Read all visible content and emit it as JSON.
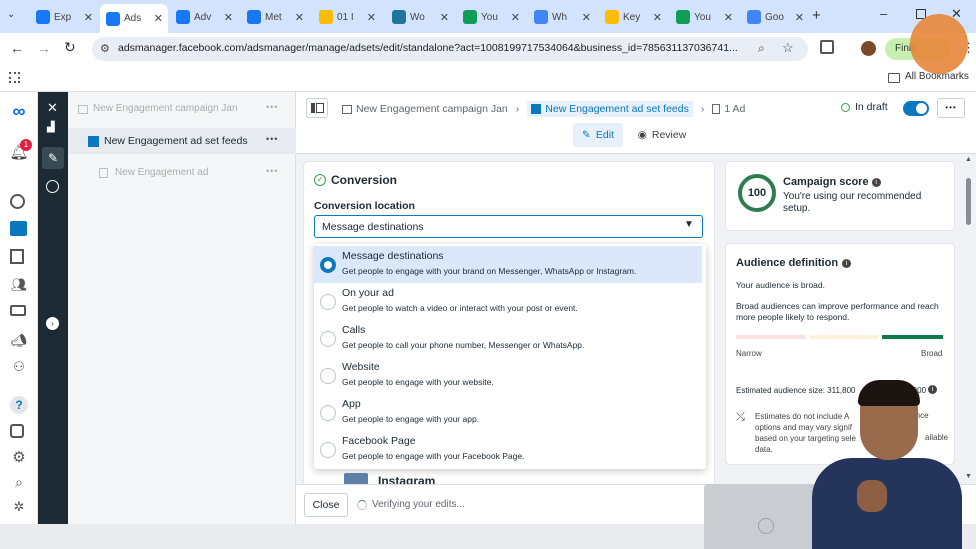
{
  "browser": {
    "tabs": [
      {
        "label": "Exp",
        "color": "#1877f2",
        "icon": "meta"
      },
      {
        "label": "Ads",
        "color": "#1877f2",
        "icon": "meta"
      },
      {
        "label": "Adv",
        "color": "#1877f2",
        "icon": "meta"
      },
      {
        "label": "Met",
        "color": "#1877f2",
        "icon": "meta"
      },
      {
        "label": "01 I",
        "color": "#fbbc04",
        "icon": "drive"
      },
      {
        "label": "Wo",
        "color": "#21759b",
        "icon": "wordpress"
      },
      {
        "label": "You",
        "color": "#0f9d58",
        "icon": "sheets"
      },
      {
        "label": "Wh",
        "color": "#4285f4",
        "icon": "google"
      },
      {
        "label": "Key",
        "color": "#fbbc04",
        "icon": "google-ads"
      },
      {
        "label": "You",
        "color": "#0f9d58",
        "icon": "sheets"
      },
      {
        "label": "Goo",
        "color": "#4285f4",
        "icon": "google"
      }
    ],
    "active_tab": 1,
    "url": "adsmanager.facebook.com/adsmanager/manage/adsets/edit/standalone?act=1008199717534064&business_id=785631137036741...",
    "profile_button": "Finis",
    "all_bookmarks": "All Bookmarks"
  },
  "sidebar": {
    "notification_count": "1",
    "icons": [
      "meta-logo-icon",
      "notifications-icon",
      "dashboard-icon",
      "campaigns-icon",
      "pages-icon",
      "audiences-icon",
      "billing-icon",
      "ads-icon",
      "network-icon",
      "help-icon",
      "reports-icon",
      "settings-icon",
      "search-icon",
      "bug-icon"
    ]
  },
  "tree": {
    "campaign": "New Engagement campaign Jan",
    "adset": "New Engagement ad set feeds",
    "ad": "New Engagement ad",
    "more": "•••"
  },
  "topbar": {
    "crumb_campaign": "New Engagement campaign Jan",
    "crumb_adset": "New Engagement ad set feeds",
    "crumb_ad": "1 Ad",
    "status": "In draft",
    "edit": "Edit",
    "review": "Review",
    "more": "•••"
  },
  "conversion": {
    "title": "Conversion",
    "location_label": "Conversion location",
    "selected": "Message destinations",
    "options": [
      {
        "label": "Message destinations",
        "desc": "Get people to engage with your brand on Messenger, WhatsApp or Instagram.",
        "selected": true
      },
      {
        "label": "On your ad",
        "desc": "Get people to watch a video or interact with your post or event.",
        "selected": false
      },
      {
        "label": "Calls",
        "desc": "Get people to call your phone number, Messenger or WhatsApp.",
        "selected": false
      },
      {
        "label": "Website",
        "desc": "Get people to engage with your website.",
        "selected": false
      },
      {
        "label": "App",
        "desc": "Get people to engage with your app.",
        "selected": false
      },
      {
        "label": "Facebook Page",
        "desc": "Get people to engage with your Facebook Page.",
        "selected": false
      }
    ],
    "below_item": "Instagram"
  },
  "campaign_score": {
    "score": "100",
    "title": "Campaign score",
    "text": "You're using our recommended setup."
  },
  "audience": {
    "title": "Audience definition",
    "status": "Your audience is broad.",
    "hint": "Broad audiences can improve performance and reach more people likely to respond.",
    "narrow": "Narrow",
    "broad": "Broad",
    "estimated": "Estimated audience size: 311,800",
    "estimated_tail": "0,000",
    "note_line1": "Estimates do not include A",
    "note_line1_tail": "dience",
    "note_line2": "options and may vary signif",
    "note_line3": "based on your targeting sele",
    "note_line3_tail": "ailable",
    "note_line4": "data."
  },
  "footer": {
    "close": "Close",
    "verifying": "Verifying your edits..."
  },
  "colors": {
    "accent": "#0a78be",
    "score_green": "#2e7d4f",
    "selected_row": "#dbe8fb",
    "dark_rail": "#1c2b33"
  }
}
